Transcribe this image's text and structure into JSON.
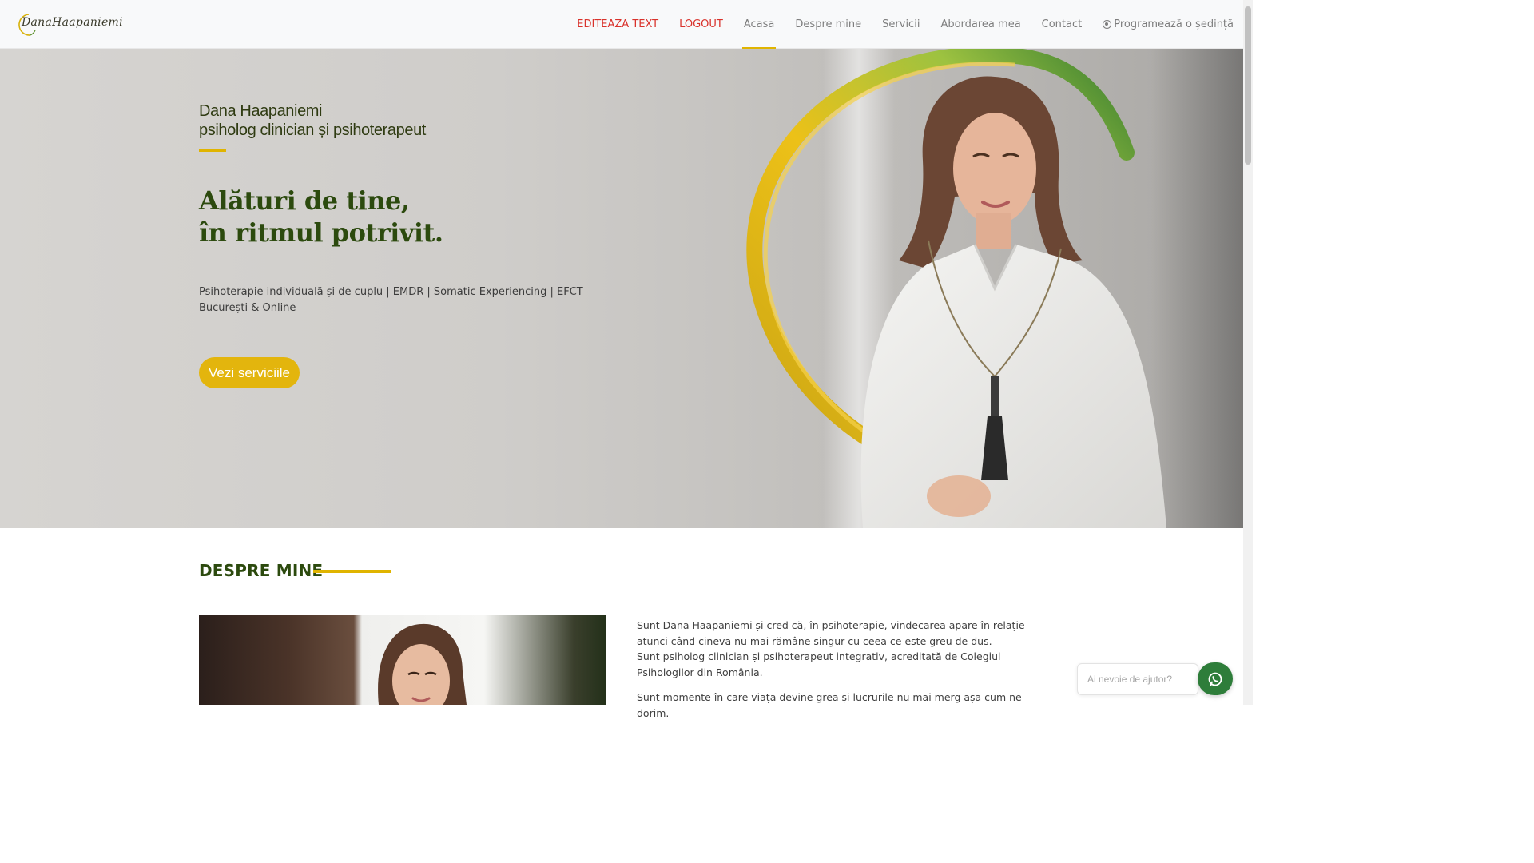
{
  "logo": {
    "text": "DanaHaapaniemi"
  },
  "nav": {
    "items": [
      {
        "label": "EDITEAZA TEXT"
      },
      {
        "label": "LOGOUT"
      },
      {
        "label": "Acasa"
      },
      {
        "label": "Despre mine"
      },
      {
        "label": "Servicii"
      },
      {
        "label": "Abordarea mea"
      },
      {
        "label": "Contact"
      },
      {
        "label": "Programează o ședință"
      }
    ],
    "active_index": 2
  },
  "hero": {
    "name": "Dana Haapaniemi",
    "role": "psiholog clinician și psihoterapeut",
    "title_line1": "Alături de tine,",
    "title_line2": "în ritmul potrivit.",
    "subtitle_line1": "Psihoterapie individuală și de cuplu | EMDR | Somatic Experiencing | EFCT",
    "subtitle_line2": "București & Online",
    "button": "Vezi serviciile"
  },
  "about": {
    "heading": "DESPRE MINE",
    "paragraph1_line1": "Sunt Dana Haapaniemi și cred că, în psihoterapie, vindecarea apare în relație - atunci când cineva nu mai rămâne singur cu ceea ce este greu de dus.",
    "paragraph1_line2": "Sunt psiholog clinician și psihoterapeut integrativ, acreditată de Colegiul Psihologilor din România.",
    "paragraph2": "Sunt momente în care viața devine grea și lucrurile nu mai merg așa cum ne dorim."
  },
  "help_widget": {
    "placeholder": "Ai nevoie de ajutor?"
  },
  "colors": {
    "accent": "#e0b400",
    "brand_green": "#2c4a0e",
    "admin_red": "#d9322b",
    "whatsapp_green": "#2e7d3a"
  },
  "icons": {
    "whatsapp": "whatsapp-icon"
  }
}
